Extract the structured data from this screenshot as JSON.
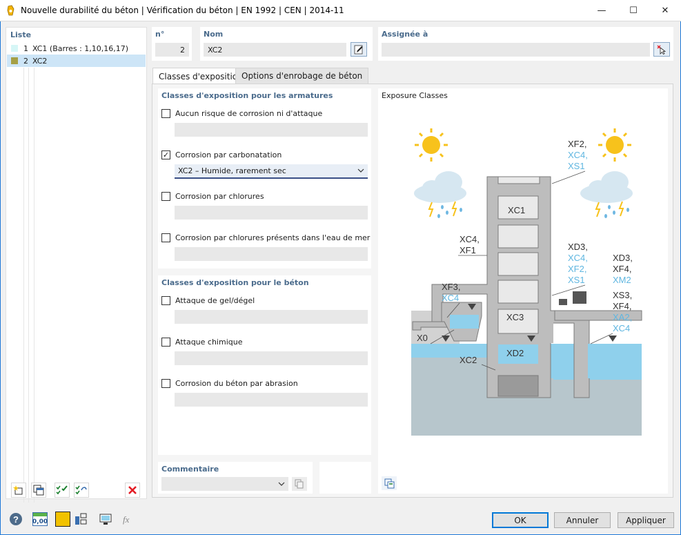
{
  "window": {
    "title": "Nouvelle durabilité du béton | Vérification du béton | EN 1992 | CEN | 2014-11",
    "minimize": "—",
    "maximize": "☐",
    "close": "✕"
  },
  "list": {
    "header": "Liste",
    "items": [
      {
        "num": "1",
        "label": "XC1 (Barres : 1,10,16,17)",
        "color": "#d6f6f6"
      },
      {
        "num": "2",
        "label": "XC2",
        "color": "#a6a046"
      }
    ]
  },
  "header": {
    "number_label": "n°",
    "number_value": "2",
    "name_label": "Nom",
    "name_value": "XC2",
    "assigned_label": "Assignée à",
    "assigned_value": ""
  },
  "tabs": [
    {
      "label": "Classes d'exposition"
    },
    {
      "label": "Options d'enrobage de béton"
    }
  ],
  "reinforcement": {
    "header": "Classes d'exposition pour les armatures",
    "options": [
      {
        "label": "Aucun risque de corrosion ni d'attaque",
        "checked": false,
        "value": ""
      },
      {
        "label": "Corrosion par carbonatation",
        "checked": true,
        "value": "XC2 – Humide, rarement sec"
      },
      {
        "label": "Corrosion par chlorures",
        "checked": false,
        "value": ""
      },
      {
        "label": "Corrosion par chlorures présents dans l'eau de mer",
        "checked": false,
        "value": ""
      }
    ]
  },
  "concrete": {
    "header": "Classes d'exposition pour le béton",
    "options": [
      {
        "label": "Attaque de gel/dégel",
        "checked": false
      },
      {
        "label": "Attaque chimique",
        "checked": false
      },
      {
        "label": "Corrosion du béton par abrasion",
        "checked": false
      }
    ]
  },
  "comment": {
    "header": "Commentaire",
    "value": ""
  },
  "image": {
    "title": "Exposure Classes",
    "labels": {
      "tr_black": "XF2,",
      "tr_blue1": "XC4,",
      "tr_blue2": "XS1",
      "xc1": "XC1",
      "xc4xf1_a": "XC4,",
      "xc4xf1_b": "XF1",
      "xd3_a": "XD3,",
      "xd3_b": "XC4,",
      "xd3_c": "XF2,",
      "xd3_d": "XS1",
      "xd3r_a": "XD3,",
      "xd3r_b": "XF4,",
      "xd3r_c": "XM2",
      "xf3_a": "XF3,",
      "xf3_b": "XC4",
      "xc3": "XC3",
      "xs3_a": "XS3,",
      "xs3_b": "XF4,",
      "xs3_c": "XA2,",
      "xs3_d": "XC4",
      "x0": "X0",
      "xd2": "XD2",
      "xc2": "XC2"
    }
  },
  "footer": {
    "ok": "OK",
    "cancel": "Annuler",
    "apply": "Appliquer",
    "number_icon": "0,00"
  },
  "colors": {
    "accent": "#0078d7",
    "section_header": "#4a6b8c",
    "water": "#8fd0ec",
    "ground": "#b7c6cc",
    "structure": "#bdbdbd",
    "sun": "#f7c21c",
    "blue_label": "#5fb6e0",
    "delete_red": "#e31b23",
    "color_yellow": "#f2c200"
  }
}
